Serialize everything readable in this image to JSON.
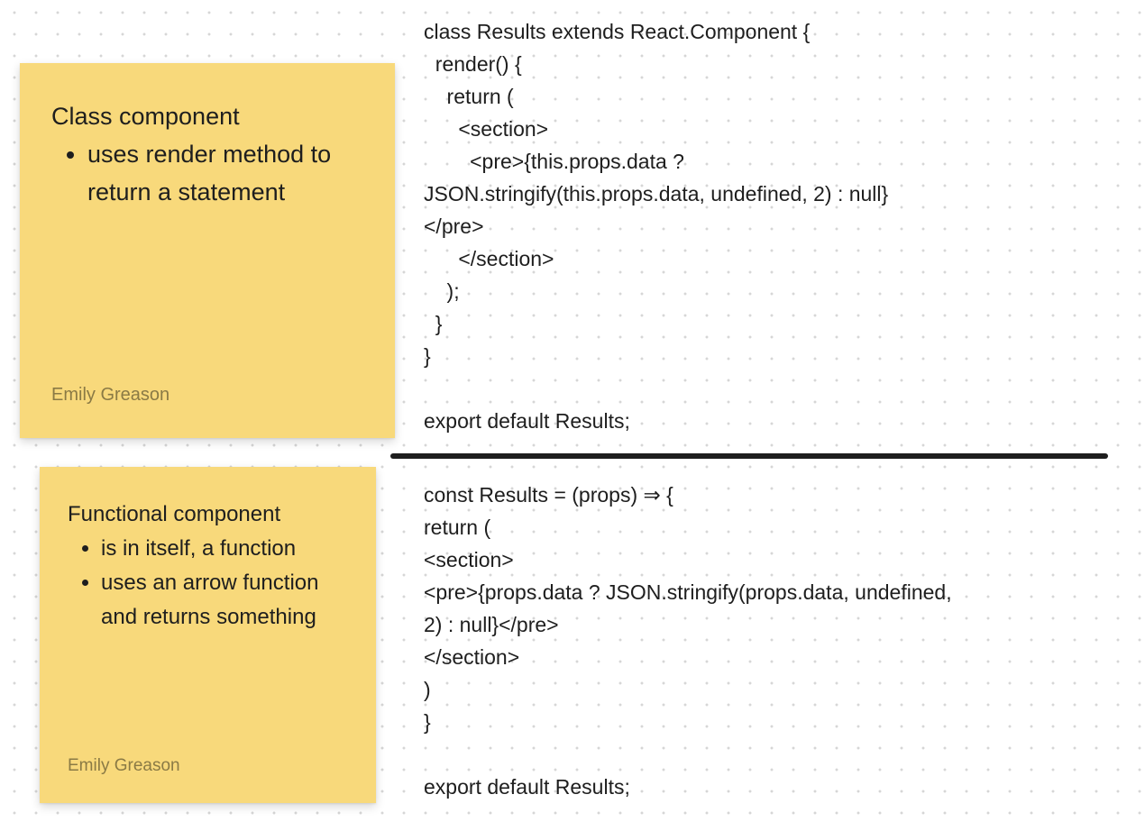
{
  "stickies": [
    {
      "title": "Class component",
      "bullets": [
        "uses render method to return a statement"
      ],
      "author": "Emily Greason",
      "color": "#f8d97b"
    },
    {
      "title": "Functional component",
      "bullets": [
        "is in itself, a function",
        "uses an arrow function and returns something"
      ],
      "author": "Emily Greason",
      "color": "#f8d97b"
    }
  ],
  "code_blocks": [
    {
      "text": "class Results extends React.Component {\n  render() {\n    return (\n      <section>\n        <pre>{this.props.data ?\nJSON.stringify(this.props.data, undefined, 2) : null}\n</pre>\n      </section>\n    );\n  }\n}\n\nexport default Results;"
    },
    {
      "text": "const Results = (props) ⇒ {\nreturn (\n<section>\n<pre>{props.data ? JSON.stringify(props.data, undefined,\n2) : null}</pre>\n</section>\n)\n}\n\nexport default Results;"
    }
  ],
  "canvas": {
    "background": "#ffffff",
    "dot_color": "#d6d6d6",
    "divider_color": "#1e1e1e"
  }
}
